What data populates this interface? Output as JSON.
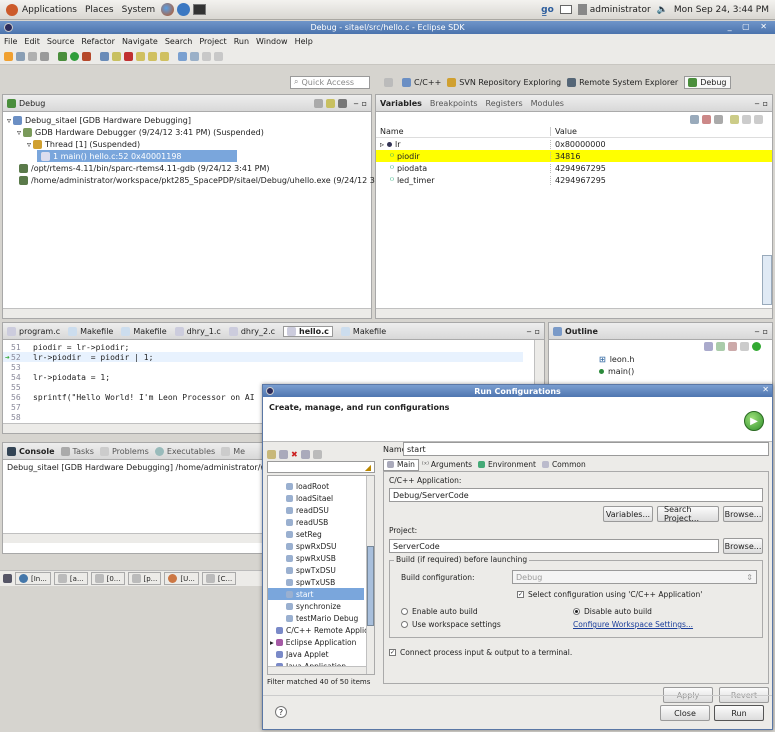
{
  "top_panel": {
    "menus": [
      "Applications",
      "Places",
      "System"
    ],
    "user": "administrator",
    "datetime": "Mon Sep 24,  3:44 PM"
  },
  "window": {
    "title": "Debug - sitael/src/hello.c - Eclipse SDK",
    "menu": [
      "File",
      "Edit",
      "Source",
      "Refactor",
      "Navigate",
      "Search",
      "Project",
      "Run",
      "Window",
      "Help"
    ],
    "quick_access_placeholder": "Quick Access",
    "perspectives": [
      "C/C++",
      "SVN Repository Exploring",
      "Remote System Explorer",
      "Debug"
    ]
  },
  "debug_view": {
    "title": "Debug",
    "items": [
      "Debug_sitael [GDB Hardware Debugging]",
      "GDB Hardware Debugger (9/24/12 3:41 PM) (Suspended)",
      "Thread [1] (Suspended)",
      "1 main() hello.c:52 0x40001198",
      "/opt/rtems-4.11/bin/sparc-rtems4.11-gdb (9/24/12 3:41 PM)",
      "/home/administrator/workspace/pkt285_SpacePDP/sitael/Debug/uhello.exe (9/24/12 3:"
    ]
  },
  "variables_view": {
    "tabs": [
      "Variables",
      "Breakpoints",
      "Registers",
      "Modules"
    ],
    "columns": [
      "Name",
      "Value"
    ],
    "rows": [
      {
        "name": "lr",
        "value": "0x80000000"
      },
      {
        "name": "piodir",
        "value": "34816"
      },
      {
        "name": "piodata",
        "value": "4294967295"
      },
      {
        "name": "led_timer",
        "value": "4294967295"
      }
    ]
  },
  "editor": {
    "tabs": [
      "program.c",
      "Makefile",
      "Makefile",
      "dhry_1.c",
      "dhry_2.c",
      "hello.c",
      "Makefile"
    ],
    "lines": [
      {
        "num": "51",
        "code": "piodir = lr->piodir;"
      },
      {
        "num": "52",
        "code": "lr->piodir  = piodir | 1;"
      },
      {
        "num": "53",
        "code": ""
      },
      {
        "num": "54",
        "code": "lr->piodata = 1;"
      },
      {
        "num": "55",
        "code": ""
      },
      {
        "num": "56",
        "code": "sprintf(\"Hello World! I'm Leon Processor on AI"
      },
      {
        "num": "57",
        "code": ""
      },
      {
        "num": "58",
        "code": ""
      }
    ]
  },
  "outline_view": {
    "title": "Outline",
    "items": [
      "leon.h",
      "main()"
    ]
  },
  "console_view": {
    "tabs": [
      "Console",
      "Tasks",
      "Problems",
      "Executables",
      "Me"
    ],
    "text": "Debug_sitael [GDB Hardware Debugging] /home/administrator/wor"
  },
  "taskbar": {
    "items": [
      "[In...",
      "[a...",
      "[0...",
      "[p...",
      "[U...",
      "[C..."
    ]
  },
  "run_config": {
    "title": "Run Configurations",
    "header": "Create, manage, and run configurations",
    "filter_status": "Filter matched 40 of 50 items",
    "tree": [
      {
        "label": "loadRoot",
        "indent": 2
      },
      {
        "label": "loadSitael",
        "indent": 2
      },
      {
        "label": "readDSU",
        "indent": 2
      },
      {
        "label": "readUSB",
        "indent": 2
      },
      {
        "label": "setReg",
        "indent": 2
      },
      {
        "label": "spwRxDSU",
        "indent": 2
      },
      {
        "label": "spwRxUSB",
        "indent": 2
      },
      {
        "label": "spwTxDSU",
        "indent": 2
      },
      {
        "label": "spwTxUSB",
        "indent": 2
      },
      {
        "label": "start",
        "indent": 2
      },
      {
        "label": "synchronize",
        "indent": 2
      },
      {
        "label": "testMario Debug",
        "indent": 2
      },
      {
        "label": "C/C++ Remote Applica",
        "indent": 1
      },
      {
        "label": "Eclipse Application",
        "indent": 0
      },
      {
        "label": "Java Applet",
        "indent": 1
      },
      {
        "label": "Java Application",
        "indent": 1
      },
      {
        "label": "JUnit",
        "indent": 1
      }
    ],
    "name_label": "Name:",
    "name_value": "start",
    "tabs": [
      "Main",
      "Arguments",
      "Environment",
      "Common"
    ],
    "app_label": "C/C++ Application:",
    "app_value": "Debug/ServerCode",
    "variables_btn": "Variables...",
    "search_project_btn": "Search Project...",
    "browse_btn": "Browse...",
    "project_label": "Project:",
    "project_value": "ServerCode",
    "browse2_btn": "Browse...",
    "build_group": "Build (if required) before launching",
    "build_config_label": "Build configuration:",
    "build_config_value": "Debug",
    "select_config_label": "Select configuration using 'C/C++ Application'",
    "enable_auto": "Enable auto build",
    "disable_auto": "Disable auto build",
    "use_workspace": "Use workspace settings",
    "configure_link": "Configure Workspace Settings...",
    "connect_label": "Connect process input & output to a terminal.",
    "apply_btn": "Apply",
    "revert_btn": "Revert",
    "close_btn": "Close",
    "run_btn": "Run",
    "colors": {
      "accent": "#3f6eb5",
      "highlight": "#ffff00",
      "selection": "#7aa6dc"
    }
  }
}
